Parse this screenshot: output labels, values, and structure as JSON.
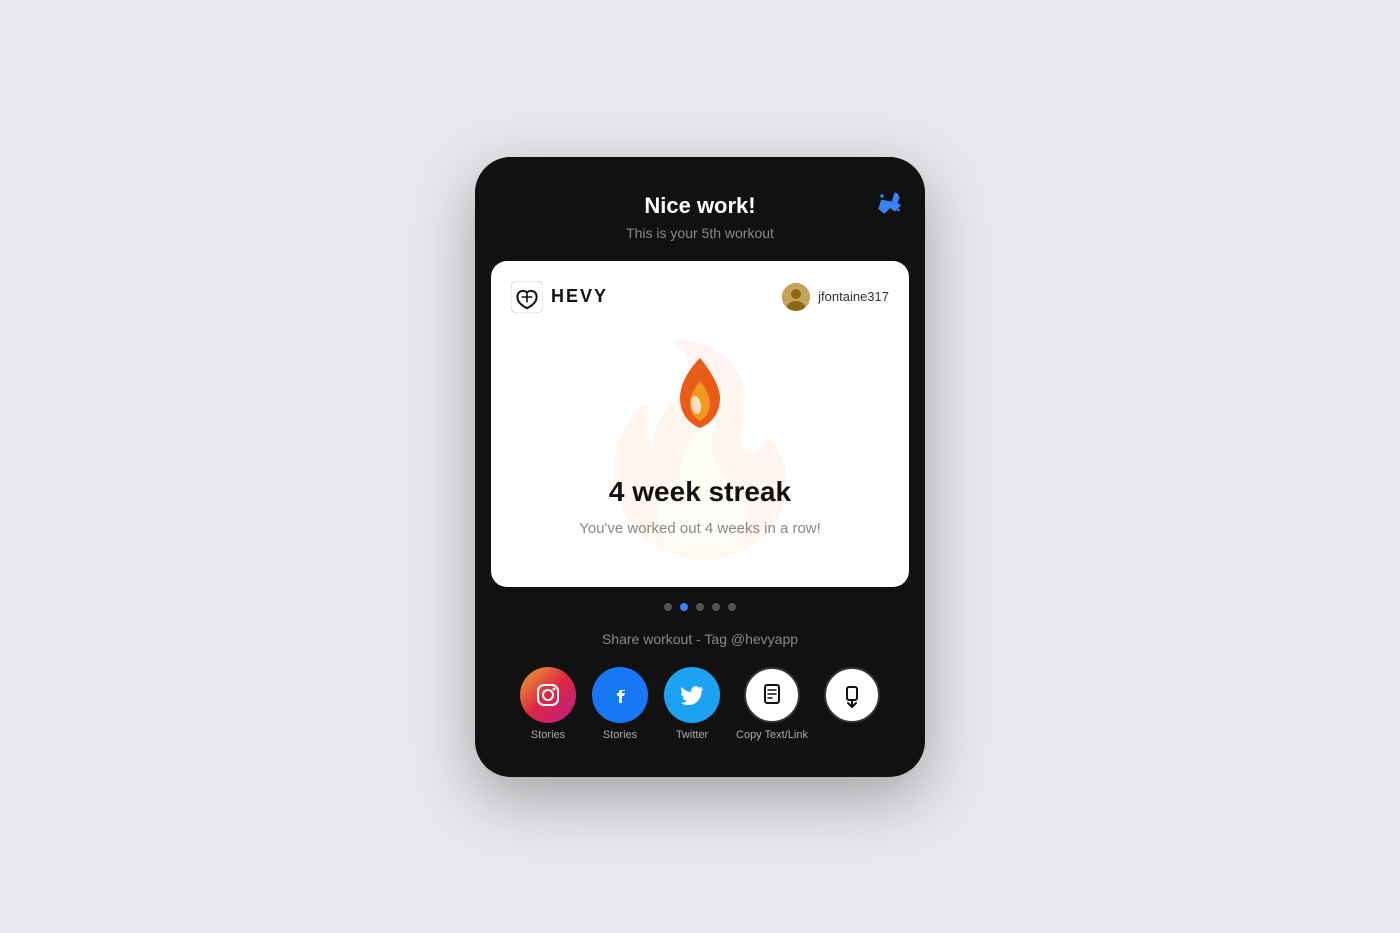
{
  "header": {
    "title": "Nice work!",
    "subtitle": "This is your 5th workout",
    "celebration_icon": "🎉"
  },
  "card": {
    "logo_text": "HEVY",
    "username": "jfontaine317",
    "streak_weeks": "4",
    "streak_title": "4 week streak",
    "streak_description": "You've worked out 4 weeks in a row!"
  },
  "pagination": {
    "total": 5,
    "active_index": 1
  },
  "share": {
    "label": "Share workout - Tag @hevyapp",
    "buttons": [
      {
        "id": "instagram-stories",
        "label": "Stories",
        "platform": "instagram"
      },
      {
        "id": "facebook-stories",
        "label": "Stories",
        "platform": "facebook"
      },
      {
        "id": "twitter",
        "label": "Twitter",
        "platform": "twitter"
      },
      {
        "id": "copy-text",
        "label": "Copy Text/Link",
        "platform": "copy"
      },
      {
        "id": "more",
        "label": "",
        "platform": "more"
      }
    ]
  }
}
